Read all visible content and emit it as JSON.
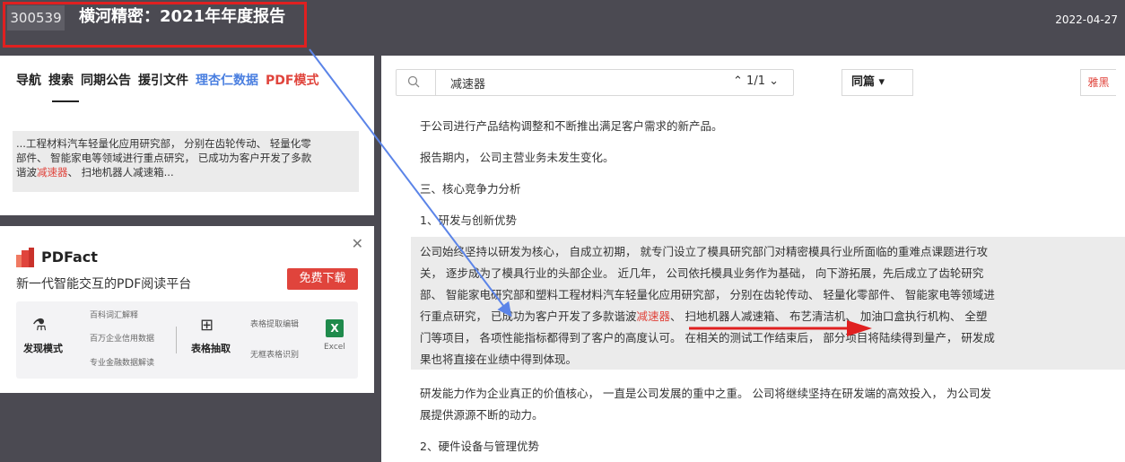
{
  "header": {
    "stock_code": "300539",
    "title": "横河精密：2021年年度报告",
    "date": "2022-04-27"
  },
  "left_nav": {
    "tabs": [
      {
        "label": "导航",
        "color": "default"
      },
      {
        "label": "搜索",
        "color": "default",
        "active": true
      },
      {
        "label": "同期公告",
        "color": "default"
      },
      {
        "label": "援引文件",
        "color": "default"
      },
      {
        "label": "理杏仁数据",
        "color": "blue"
      },
      {
        "label": "PDF模式",
        "color": "red"
      }
    ],
    "snippet": {
      "line1": "...工程材料汽车轻量化应用研究部， 分别在齿轮传动、 轻量化零",
      "line2": "部件、 智能家电等领域进行重点研究， 已成功为客户开发了多款",
      "line3_pre": "谐波",
      "line3_hl": "减速器",
      "line3_post": "、 扫地机器人减速箱..."
    }
  },
  "ad": {
    "brand": "PDFact",
    "tagline": "新一代智能交互的PDF阅读平台",
    "download_label": "免费下载",
    "close_icon": "close-icon",
    "discover_label": "发现模式",
    "discover_items": [
      "百科词汇解释",
      "百万企业信用数据",
      "专业金融数据解读"
    ],
    "table_label": "表格抽取",
    "table_items": [
      "表格提取编辑",
      "无框表格识别"
    ],
    "excel_label": "Excel"
  },
  "search": {
    "query": "减速器",
    "match_count": "1/1",
    "scope": "同篇",
    "theme_label": "雅黑"
  },
  "document": {
    "line1": "于公司进行产品结构调整和不断推出满足客户需求的新产品。",
    "line2": "报告期内， 公司主营业务未发生变化。",
    "line3": "三、核心竞争力分析",
    "line4": "1、研发与创新优势",
    "block_lines": [
      "公司始终坚持以研发为核心， 自成立初期， 就专门设立了模具研究部门对精密模具行业所面临的重难点课题进行攻",
      "关， 逐步成为了模具行业的头部企业。 近几年， 公司依托模具业务作为基础， 向下游拓展，先后成立了齿轮研究",
      "部、 智能家电研究部和塑料工程材料汽车轻量化应用研究部， 分别在齿轮传动、 轻量化零部件、 智能家电等领域进"
    ],
    "block_line4_pre": "行重点研究， 已成功为客户开发了多款谐波",
    "block_line4_hl": "减速器",
    "block_line4_post": "、 扫地机器人减速箱、 布艺清洁机、 加油口盒执行机构、 全塑",
    "block_line5": "门等项目， 各项性能指标都得到了客户的高度认可。 在相关的测试工作结束后， 部分项目将陆续得到量产， 研发成",
    "block_line6": "果也将直接在业绩中得到体现。",
    "line5": "研发能力作为企业真正的价值核心， 一直是公司发展的重中之重。 公司将继续坚持在研发端的高效投入， 为公司发",
    "line6": "展提供源源不断的动力。",
    "line7": "2、硬件设备与管理优势"
  },
  "colors": {
    "header_bg": "#4b4a52",
    "accent_red": "#e0443c",
    "accent_blue": "#4a7fe0",
    "annotation_red": "#e02020",
    "annotation_blue": "#5b84e8"
  }
}
